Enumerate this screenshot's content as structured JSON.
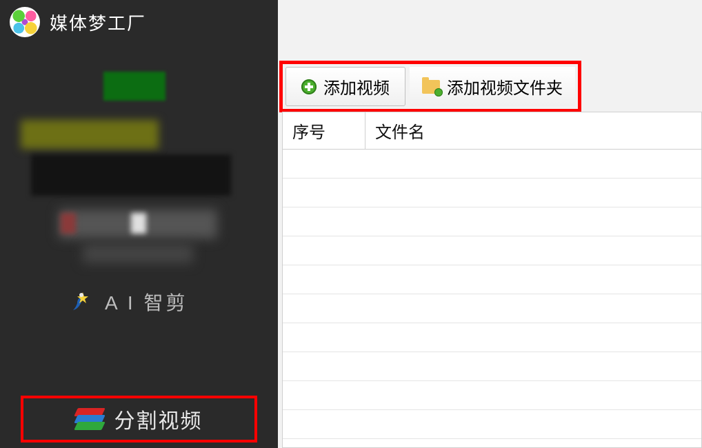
{
  "app": {
    "title": "媒体梦工厂"
  },
  "sidebar": {
    "items": [
      {
        "label": "A I 智剪",
        "icon": "wizard-icon"
      },
      {
        "label": "分割视频",
        "icon": "stack-icon",
        "highlighted": true
      }
    ]
  },
  "toolbar": {
    "buttons": [
      {
        "label": "添加视频",
        "icon": "add-icon"
      },
      {
        "label": "添加视频文件夹",
        "icon": "folder-add-icon"
      }
    ]
  },
  "table": {
    "columns": [
      {
        "label": "序号"
      },
      {
        "label": "文件名"
      }
    ],
    "rows": []
  },
  "colors": {
    "highlight_border": "#ff0000",
    "sidebar_bg": "#2a2a2a",
    "main_bg": "#f2f2f2"
  }
}
